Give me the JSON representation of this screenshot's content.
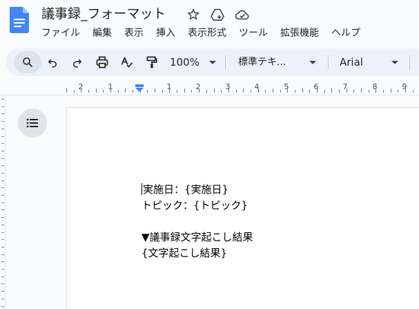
{
  "document": {
    "title": "議事録_フォーマット"
  },
  "menu": {
    "items": [
      "ファイル",
      "編集",
      "表示",
      "挿入",
      "表示形式",
      "ツール",
      "拡張機能",
      "ヘルプ"
    ]
  },
  "toolbar": {
    "zoom": "100%",
    "style": "標準テキ...",
    "font": "Arial"
  },
  "ruler": {
    "labels": [
      "2",
      "1",
      "1",
      "2",
      "3",
      "4",
      "5",
      "6",
      "7",
      "8",
      "9"
    ]
  },
  "body": {
    "lines": [
      "実施日：{実施日}",
      "トピック：{トピック}",
      "",
      "▼議事録文字起こし結果",
      "{文字起こし結果}"
    ]
  },
  "colors": {
    "accent": "#4285f4",
    "toolbar_bg": "#edf2fa",
    "page_bg": "#ffffff",
    "app_bg": "#f9fbfd"
  }
}
